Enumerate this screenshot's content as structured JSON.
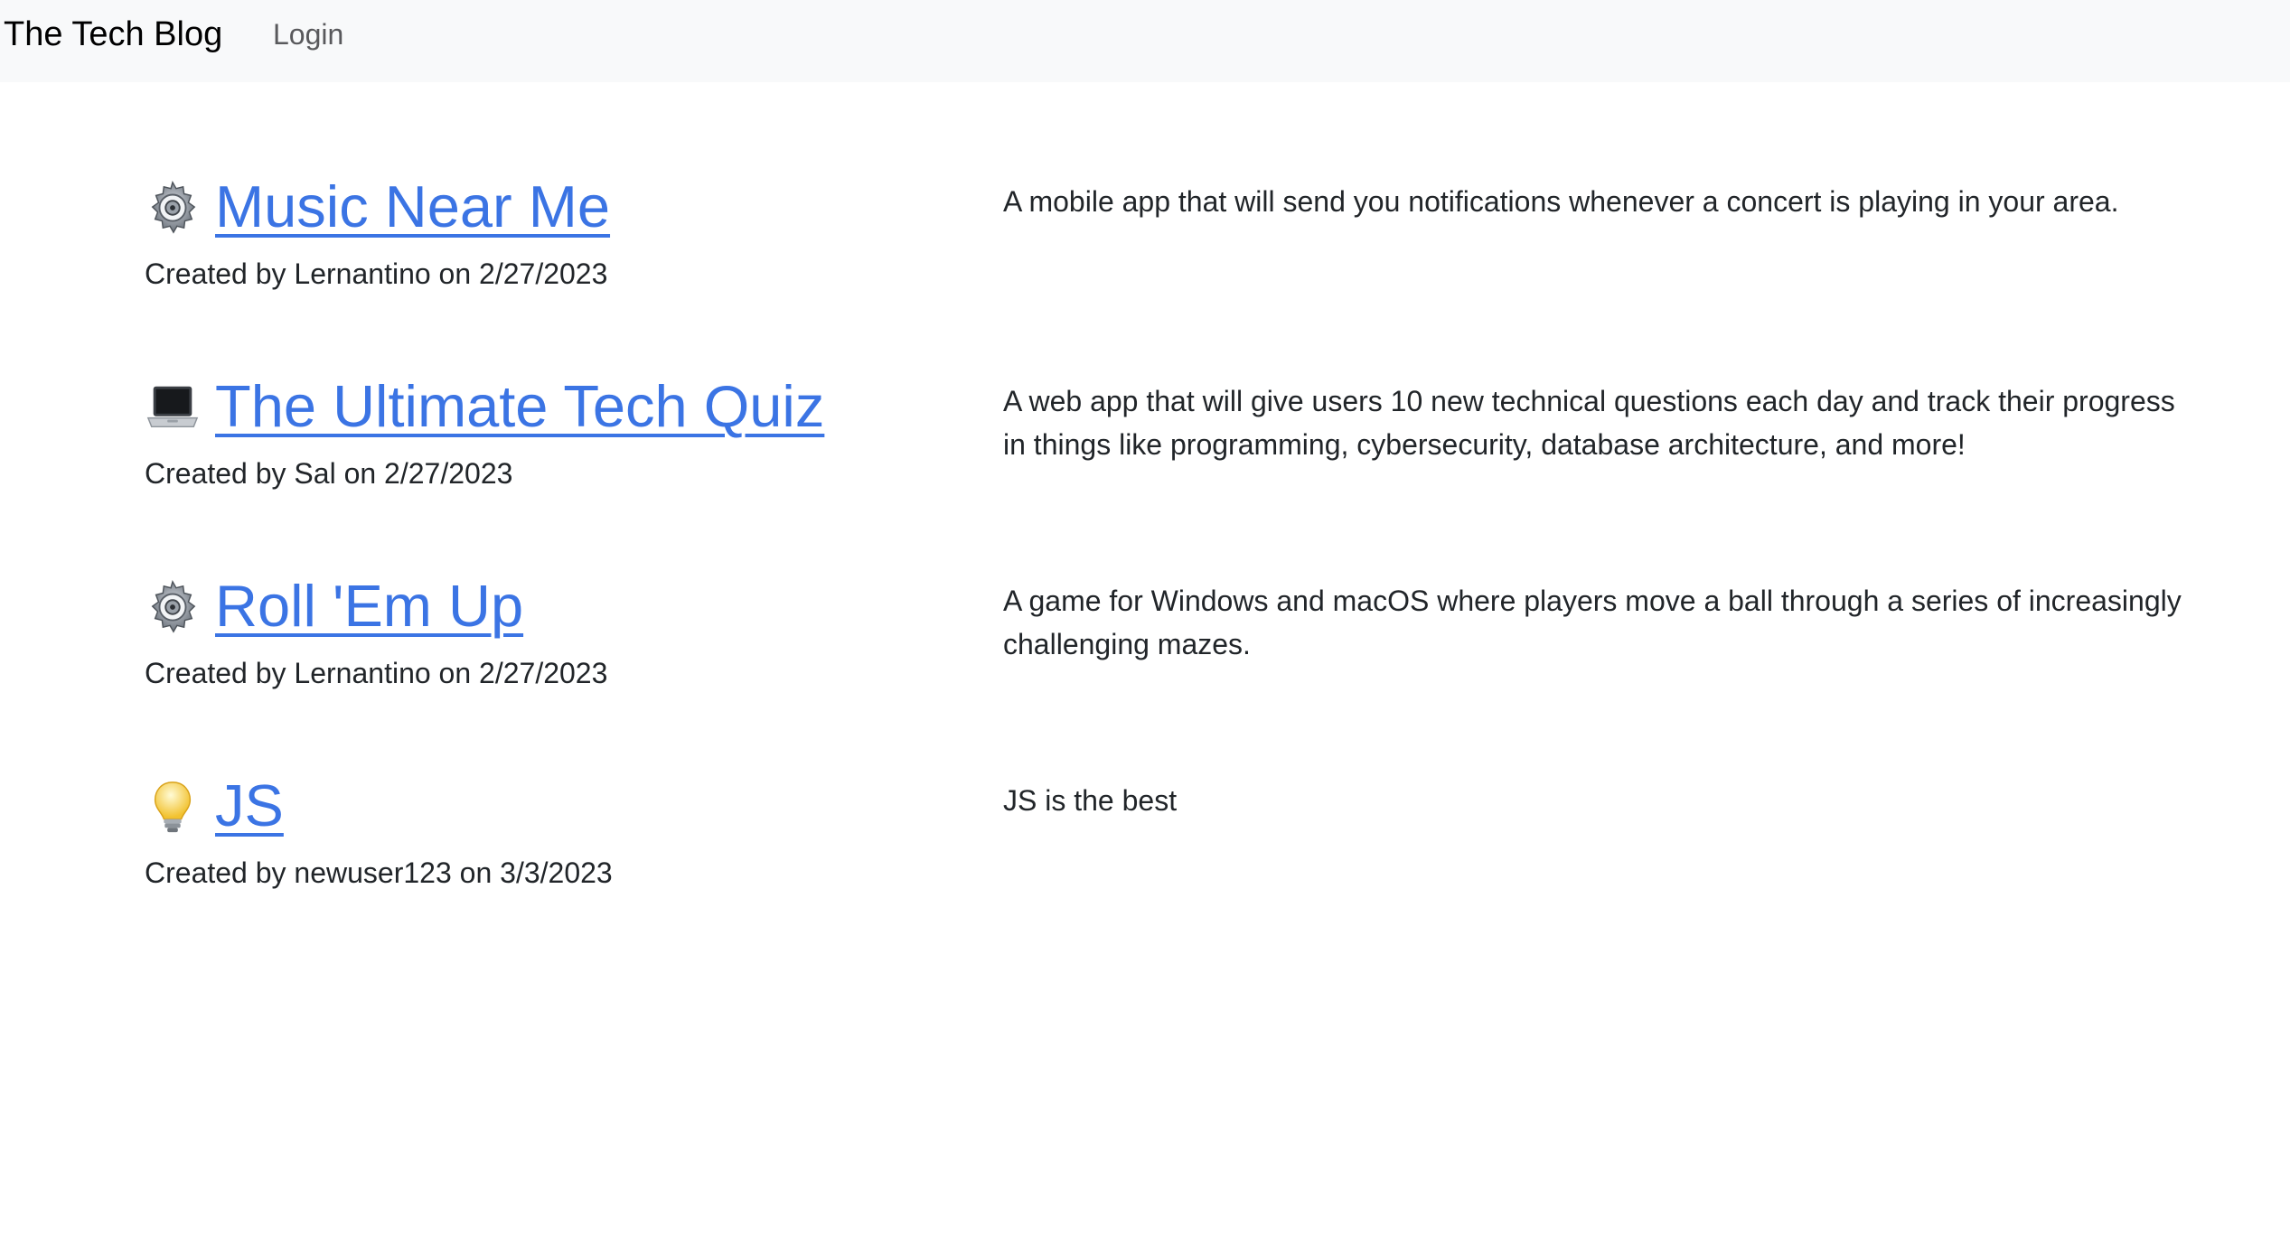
{
  "navbar": {
    "brand": "The Tech Blog",
    "login_label": "Login"
  },
  "posts": [
    {
      "icon": "gear-icon",
      "title": "Music Near Me",
      "meta": "Created by Lernantino on 2/27/2023",
      "description": "A mobile app that will send you notifications whenever a concert is playing in your area."
    },
    {
      "icon": "laptop-icon",
      "title": "The Ultimate Tech Quiz",
      "meta": "Created by Sal on 2/27/2023",
      "description": "A web app that will give users 10 new technical questions each day and track their progress in things like programming, cybersecurity, database architecture, and more!"
    },
    {
      "icon": "gear-icon",
      "title": "Roll 'Em Up",
      "meta": "Created by Lernantino on 2/27/2023",
      "description": "A game for Windows and macOS where players move a ball through a series of increasingly challenging mazes."
    },
    {
      "icon": "lightbulb-icon",
      "title": "JS",
      "meta": "Created by newuser123 on 3/3/2023",
      "description": "JS is the best"
    }
  ],
  "colors": {
    "navbar_bg": "#f8f9fa",
    "link": "#3b74e4",
    "text": "#212529",
    "nav_muted": "#59595c"
  }
}
